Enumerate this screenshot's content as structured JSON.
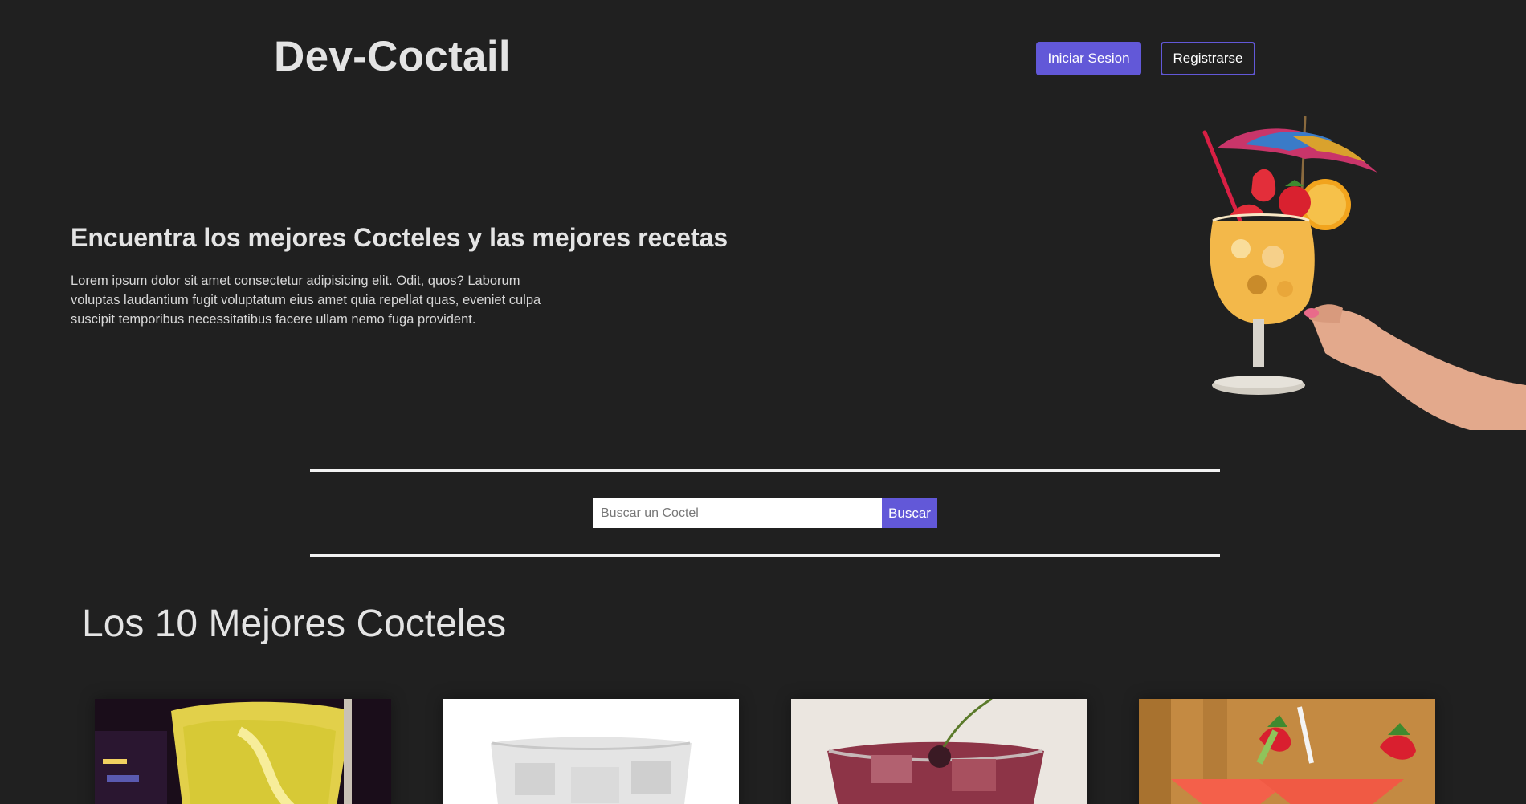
{
  "header": {
    "brand": "Dev-Coctail",
    "login_label": "Iniciar Sesion",
    "register_label": "Registrarse"
  },
  "hero": {
    "title": "Encuentra los mejores Cocteles y las mejores recetas",
    "text": "Lorem ipsum dolor sit amet consectetur adipisicing elit. Odit, quos? Laborum voluptas laudantium fugit voluptatum eius amet quia repellat quas, eveniet culpa suscipit temporibus necessitatibus facere ullam nemo fuga provident."
  },
  "search": {
    "placeholder": "Buscar un Coctel",
    "value": "",
    "button_label": "Buscar"
  },
  "section": {
    "title": "Los 10 Mejores Cocteles"
  },
  "colors": {
    "background": "#202020",
    "accent": "#6258d8"
  },
  "cards": [
    {
      "image": "yellow-lemonade-drink-image"
    },
    {
      "image": "clear-ice-drink-image"
    },
    {
      "image": "red-cherry-drink-image"
    },
    {
      "image": "strawberry-martini-drink-image"
    }
  ]
}
